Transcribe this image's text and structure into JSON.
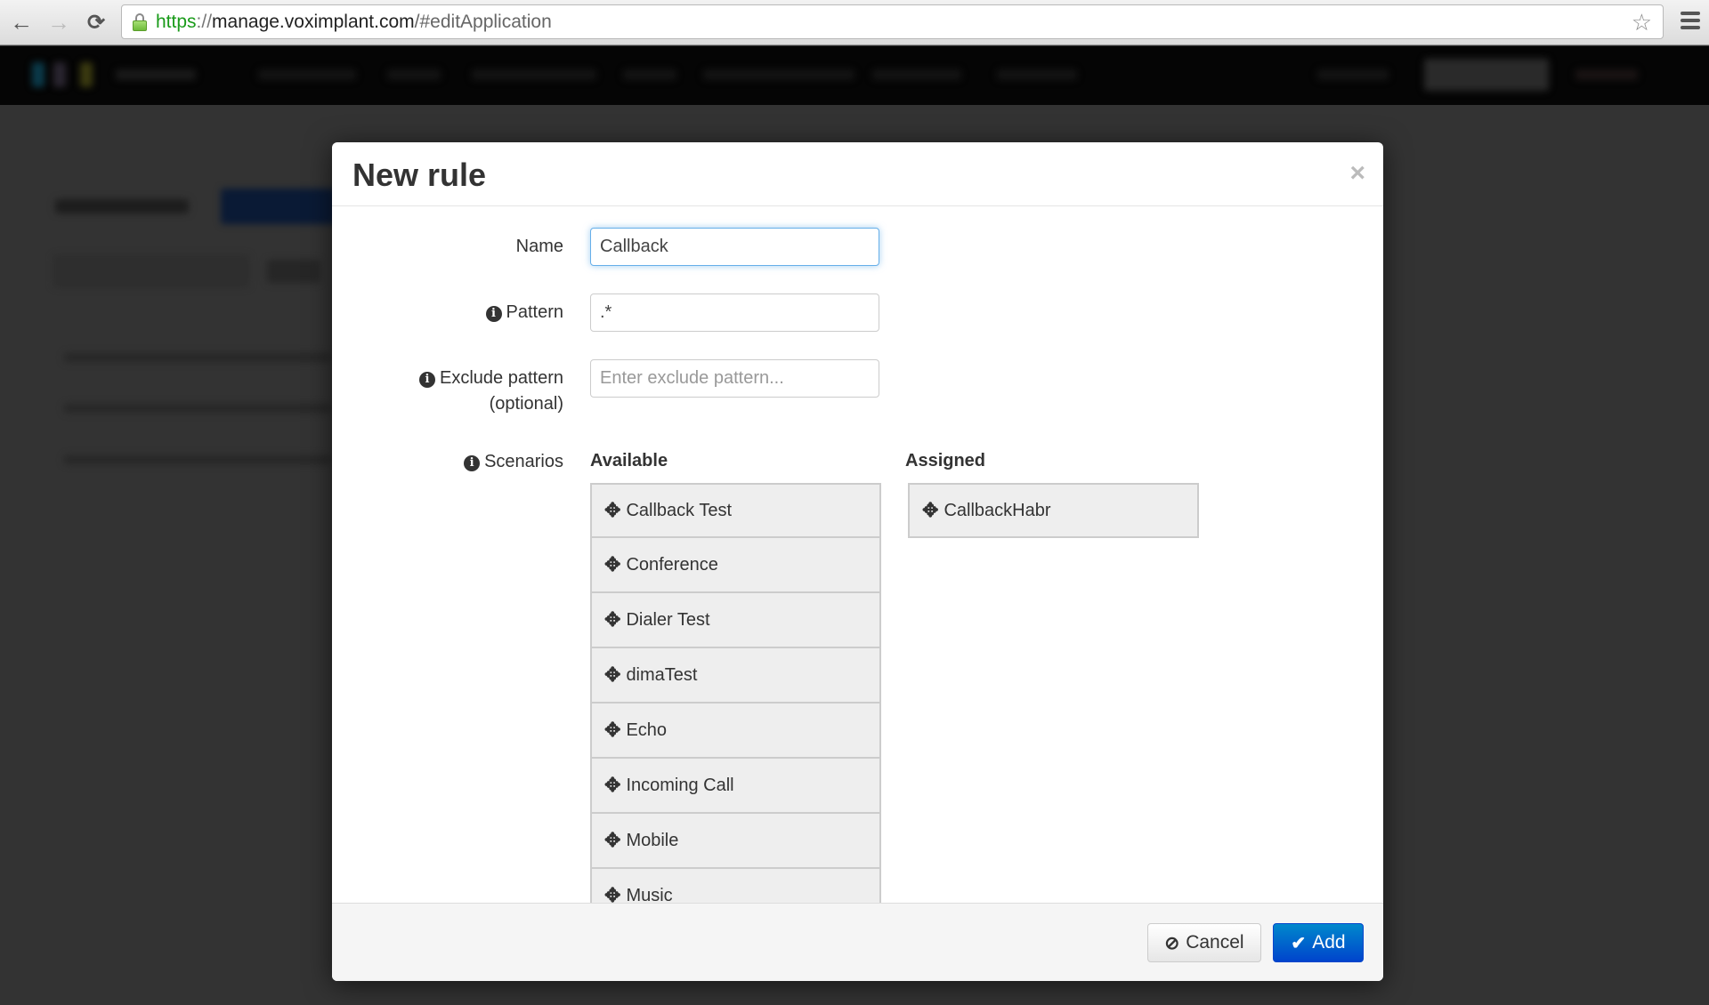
{
  "browser": {
    "url_scheme": "https",
    "url_sep": "://",
    "url_host": "manage.voximplant.com",
    "url_path": "/#editApplication",
    "back_icon": "←",
    "forward_icon": "→",
    "reload_icon": "⟳",
    "star_icon": "☆"
  },
  "modal": {
    "title": "New rule",
    "close_icon": "×",
    "form": {
      "name_label": "Name",
      "name_value": "Callback",
      "pattern_label": "Pattern",
      "pattern_value": ".*",
      "exclude_label_line1": "Exclude pattern",
      "exclude_label_line2": "(optional)",
      "exclude_placeholder": "Enter exclude pattern...",
      "exclude_value": "",
      "scenarios_label": "Scenarios",
      "info_icon": "i"
    },
    "scenarios": {
      "available_heading": "Available",
      "assigned_heading": "Assigned",
      "move_icon": "✥",
      "available": [
        {
          "label": "Callback Test"
        },
        {
          "label": "Conference"
        },
        {
          "label": "Dialer Test"
        },
        {
          "label": "dimaTest"
        },
        {
          "label": "Echo"
        },
        {
          "label": "Incoming Call"
        },
        {
          "label": "Mobile"
        },
        {
          "label": "Music"
        }
      ],
      "assigned": [
        {
          "label": "CallbackHabr"
        }
      ]
    },
    "footer": {
      "cancel_icon": "⊘",
      "cancel_label": "Cancel",
      "add_icon": "✔",
      "add_label": "Add"
    }
  },
  "colors": {
    "primary_button": "#0066cc",
    "focus_border": "#66afe9",
    "list_item_bg": "#eeeeee",
    "overlay": "#333333"
  }
}
